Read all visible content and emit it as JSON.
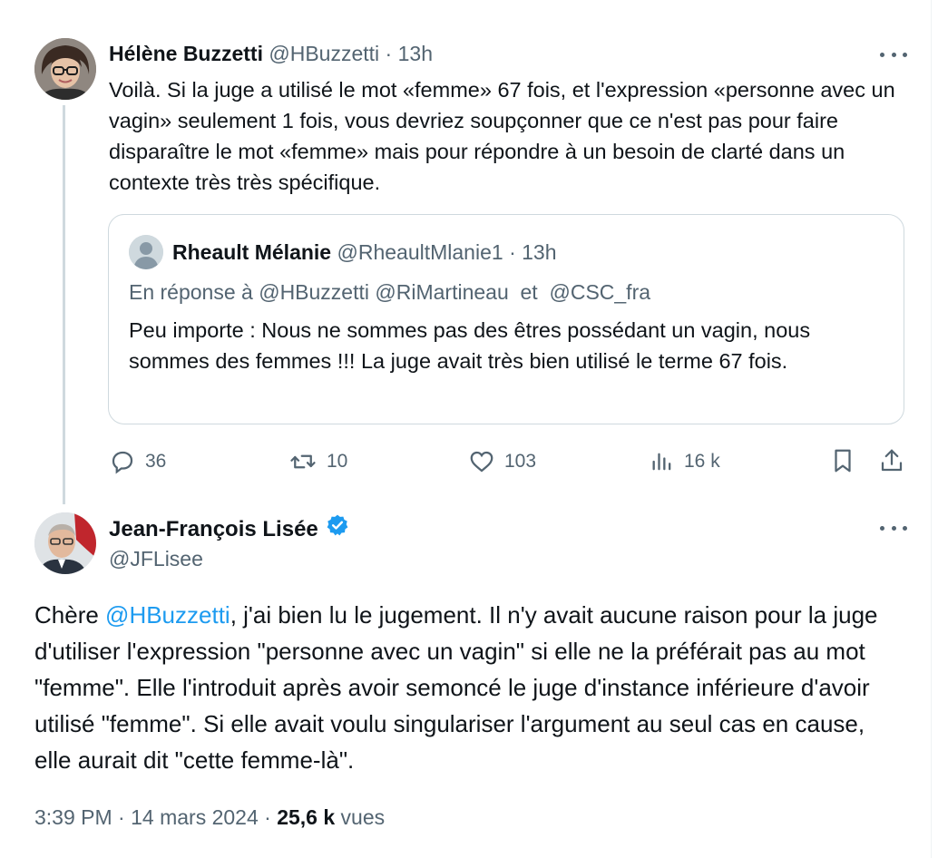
{
  "tweet1": {
    "author_name": "Hélène Buzzetti",
    "handle": "@HBuzzetti",
    "separator": "·",
    "time": "13h",
    "text": "Voilà. Si la juge a utilisé le mot «femme» 67 fois, et l'expression «personne avec un vagin» seulement 1 fois, vous devriez soupçonner que ce n'est pas pour faire disparaître le mot «femme» mais pour répondre à un besoin de clarté dans un contexte très très spécifique.",
    "quote": {
      "author_name": "Rheault Mélanie",
      "handle": "@RheaultMlanie1",
      "separator": "·",
      "time": "13h",
      "reply_prefix": "En réponse à",
      "reply_mention_1": "@HBuzzetti",
      "reply_mention_2": "@RiMartineau",
      "reply_and": "et",
      "reply_mention_3": "@CSC_fra",
      "text": "Peu importe : Nous ne sommes pas des êtres possédant un vagin, nous sommes des femmes !!! La juge avait très bien utilisé le terme 67 fois."
    },
    "actions": {
      "replies": "36",
      "reposts": "10",
      "likes": "103",
      "views": "16 k"
    }
  },
  "tweet2": {
    "author_name": "Jean-François Lisée",
    "handle": "@JFLisee",
    "text_prefix": "Chère ",
    "text_mention": "@HBuzzetti",
    "text_body": ", j'ai bien lu le jugement. Il n'y avait aucune raison pour la juge d'utiliser l'expression \"personne avec un vagin\" si elle ne la préférait pas au mot \"femme\". Elle l'introduit après avoir semoncé le juge d'instance inférieure d'avoir utilisé \"femme\". Si elle avait voulu singulariser l'argument au seul cas en cause, elle aurait dit \"cette femme-là\".",
    "time": "3:39 PM",
    "date": "14 mars 2024",
    "separator": "·",
    "views_count": "25,6 k",
    "views_label": "vues"
  },
  "colors": {
    "text": "#0f1419",
    "muted": "#536471",
    "mention": "#1d9bf0",
    "verified": "#1d9bf0",
    "border": "#cfd9de"
  },
  "icons": {
    "reply": "reply-icon",
    "repost": "repost-icon",
    "like": "heart-icon",
    "views": "views-icon",
    "bookmark": "bookmark-icon",
    "share": "share-icon",
    "more": "more-icon",
    "verified": "verified-badge-icon"
  }
}
